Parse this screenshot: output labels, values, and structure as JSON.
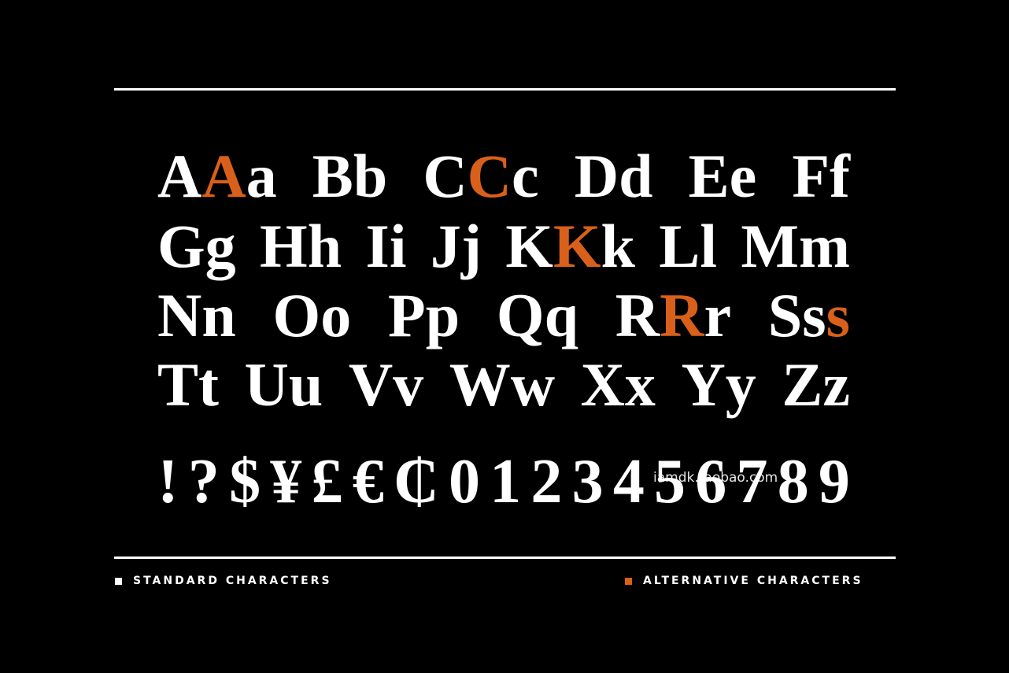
{
  "colors": {
    "standard": "#ffffff",
    "alternative": "#d9601a",
    "background": "#000000"
  },
  "alphabet_rows": [
    [
      [
        {
          "ch": "A"
        },
        {
          "ch": "A",
          "alt": true
        },
        {
          "ch": "a"
        }
      ],
      [
        {
          "ch": "B"
        },
        {
          "ch": "b"
        }
      ],
      [
        {
          "ch": "C"
        },
        {
          "ch": "C",
          "alt": true
        },
        {
          "ch": "c"
        }
      ],
      [
        {
          "ch": "D"
        },
        {
          "ch": "d"
        }
      ],
      [
        {
          "ch": "E"
        },
        {
          "ch": "e"
        }
      ],
      [
        {
          "ch": "F"
        },
        {
          "ch": "f"
        }
      ]
    ],
    [
      [
        {
          "ch": "G"
        },
        {
          "ch": "g"
        }
      ],
      [
        {
          "ch": "H"
        },
        {
          "ch": "h"
        }
      ],
      [
        {
          "ch": "I"
        },
        {
          "ch": "i"
        }
      ],
      [
        {
          "ch": "J"
        },
        {
          "ch": "j"
        }
      ],
      [
        {
          "ch": "K"
        },
        {
          "ch": "K",
          "alt": true
        },
        {
          "ch": "k"
        }
      ],
      [
        {
          "ch": "L"
        },
        {
          "ch": "l"
        }
      ],
      [
        {
          "ch": "M"
        },
        {
          "ch": "m"
        }
      ]
    ],
    [
      [
        {
          "ch": "N"
        },
        {
          "ch": "n"
        }
      ],
      [
        {
          "ch": "O"
        },
        {
          "ch": "o"
        }
      ],
      [
        {
          "ch": "P"
        },
        {
          "ch": "p"
        }
      ],
      [
        {
          "ch": "Q"
        },
        {
          "ch": "q"
        }
      ],
      [
        {
          "ch": "R"
        },
        {
          "ch": "R",
          "alt": true
        },
        {
          "ch": "r"
        }
      ],
      [
        {
          "ch": "S"
        },
        {
          "ch": "s"
        },
        {
          "ch": "s",
          "alt": true
        }
      ]
    ],
    [
      [
        {
          "ch": "T"
        },
        {
          "ch": "t"
        }
      ],
      [
        {
          "ch": "U"
        },
        {
          "ch": "u"
        }
      ],
      [
        {
          "ch": "V"
        },
        {
          "ch": "v"
        }
      ],
      [
        {
          "ch": "W"
        },
        {
          "ch": "w"
        }
      ],
      [
        {
          "ch": "X"
        },
        {
          "ch": "x"
        }
      ],
      [
        {
          "ch": "Y"
        },
        {
          "ch": "y"
        }
      ],
      [
        {
          "ch": "Z"
        },
        {
          "ch": "z"
        }
      ]
    ]
  ],
  "symbols": [
    "!",
    "?",
    "$",
    "¥",
    "£",
    "€",
    "₵",
    "0",
    "1",
    "2",
    "3",
    "4",
    "5",
    "6",
    "7",
    "8",
    "9"
  ],
  "legend": {
    "standard": "STANDARD CHARACTERS",
    "alternative": "ALTERNATIVE CHARACTERS"
  },
  "watermark": "iamdk.taobao.com"
}
